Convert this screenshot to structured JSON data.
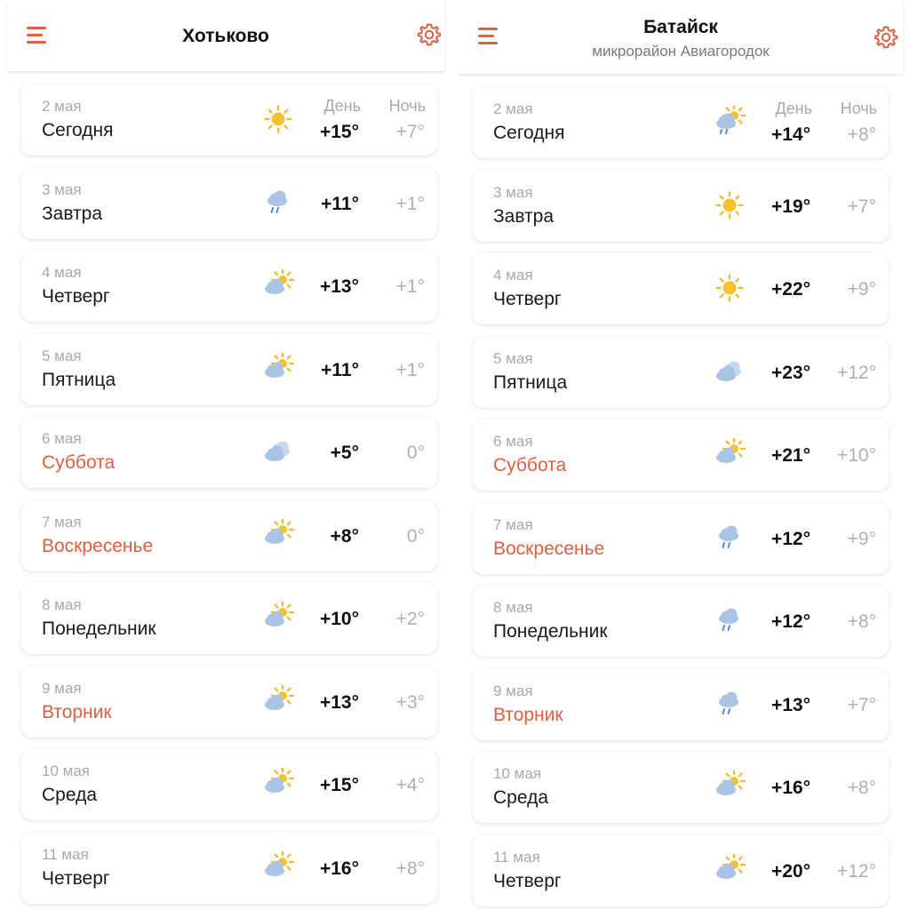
{
  "colors": {
    "accent": "#e0603f",
    "weekend": "#e06040",
    "muted": "#a9a9a9"
  },
  "left": {
    "header": {
      "menu_icon": "hamburger-menu-icon",
      "title": "Хотьково",
      "settings_icon": "gear-icon"
    },
    "labels": {
      "day": "День",
      "night": "Ночь"
    },
    "days": [
      {
        "date": "2 мая",
        "name": "Сегодня",
        "weekend": false,
        "icon": "sun",
        "day": "+15°",
        "night": "+7°"
      },
      {
        "date": "3 мая",
        "name": "Завтра",
        "weekend": false,
        "icon": "rain",
        "day": "+11°",
        "night": "+1°"
      },
      {
        "date": "4 мая",
        "name": "Четверг",
        "weekend": false,
        "icon": "partly-cloudy",
        "day": "+13°",
        "night": "+1°"
      },
      {
        "date": "5 мая",
        "name": "Пятница",
        "weekend": false,
        "icon": "partly-cloudy",
        "day": "+11°",
        "night": "+1°"
      },
      {
        "date": "6 мая",
        "name": "Суббота",
        "weekend": true,
        "icon": "cloudy",
        "day": "+5°",
        "night": "0°"
      },
      {
        "date": "7 мая",
        "name": "Воскресенье",
        "weekend": true,
        "icon": "partly-cloudy",
        "day": "+8°",
        "night": "0°"
      },
      {
        "date": "8 мая",
        "name": "Понедельник",
        "weekend": false,
        "icon": "partly-cloudy",
        "day": "+10°",
        "night": "+2°"
      },
      {
        "date": "9 мая",
        "name": "Вторник",
        "weekend": true,
        "icon": "partly-cloudy",
        "day": "+13°",
        "night": "+3°"
      },
      {
        "date": "10 мая",
        "name": "Среда",
        "weekend": false,
        "icon": "partly-cloudy",
        "day": "+15°",
        "night": "+4°"
      },
      {
        "date": "11 мая",
        "name": "Четверг",
        "weekend": false,
        "icon": "partly-cloudy",
        "day": "+16°",
        "night": "+8°"
      }
    ]
  },
  "right": {
    "header": {
      "menu_icon": "hamburger-menu-icon",
      "title": "Батайск",
      "subtitle": "микрорайон Авиагородок",
      "settings_icon": "gear-icon"
    },
    "labels": {
      "day": "День",
      "night": "Ночь"
    },
    "days": [
      {
        "date": "2 мая",
        "name": "Сегодня",
        "weekend": false,
        "icon": "sun-rain",
        "day": "+14°",
        "night": "+8°"
      },
      {
        "date": "3 мая",
        "name": "Завтра",
        "weekend": false,
        "icon": "sun",
        "day": "+19°",
        "night": "+7°"
      },
      {
        "date": "4 мая",
        "name": "Четверг",
        "weekend": false,
        "icon": "sun",
        "day": "+22°",
        "night": "+9°"
      },
      {
        "date": "5 мая",
        "name": "Пятница",
        "weekend": false,
        "icon": "cloudy",
        "day": "+23°",
        "night": "+12°"
      },
      {
        "date": "6 мая",
        "name": "Суббота",
        "weekend": true,
        "icon": "partly-cloudy",
        "day": "+21°",
        "night": "+10°"
      },
      {
        "date": "7 мая",
        "name": "Воскресенье",
        "weekend": true,
        "icon": "rain",
        "day": "+12°",
        "night": "+9°"
      },
      {
        "date": "8 мая",
        "name": "Понедельник",
        "weekend": false,
        "icon": "rain",
        "day": "+12°",
        "night": "+8°"
      },
      {
        "date": "9 мая",
        "name": "Вторник",
        "weekend": true,
        "icon": "rain",
        "day": "+13°",
        "night": "+7°"
      },
      {
        "date": "10 мая",
        "name": "Среда",
        "weekend": false,
        "icon": "partly-cloudy",
        "day": "+16°",
        "night": "+8°"
      },
      {
        "date": "11 мая",
        "name": "Четверг",
        "weekend": false,
        "icon": "partly-cloudy",
        "day": "+20°",
        "night": "+12°"
      }
    ]
  }
}
